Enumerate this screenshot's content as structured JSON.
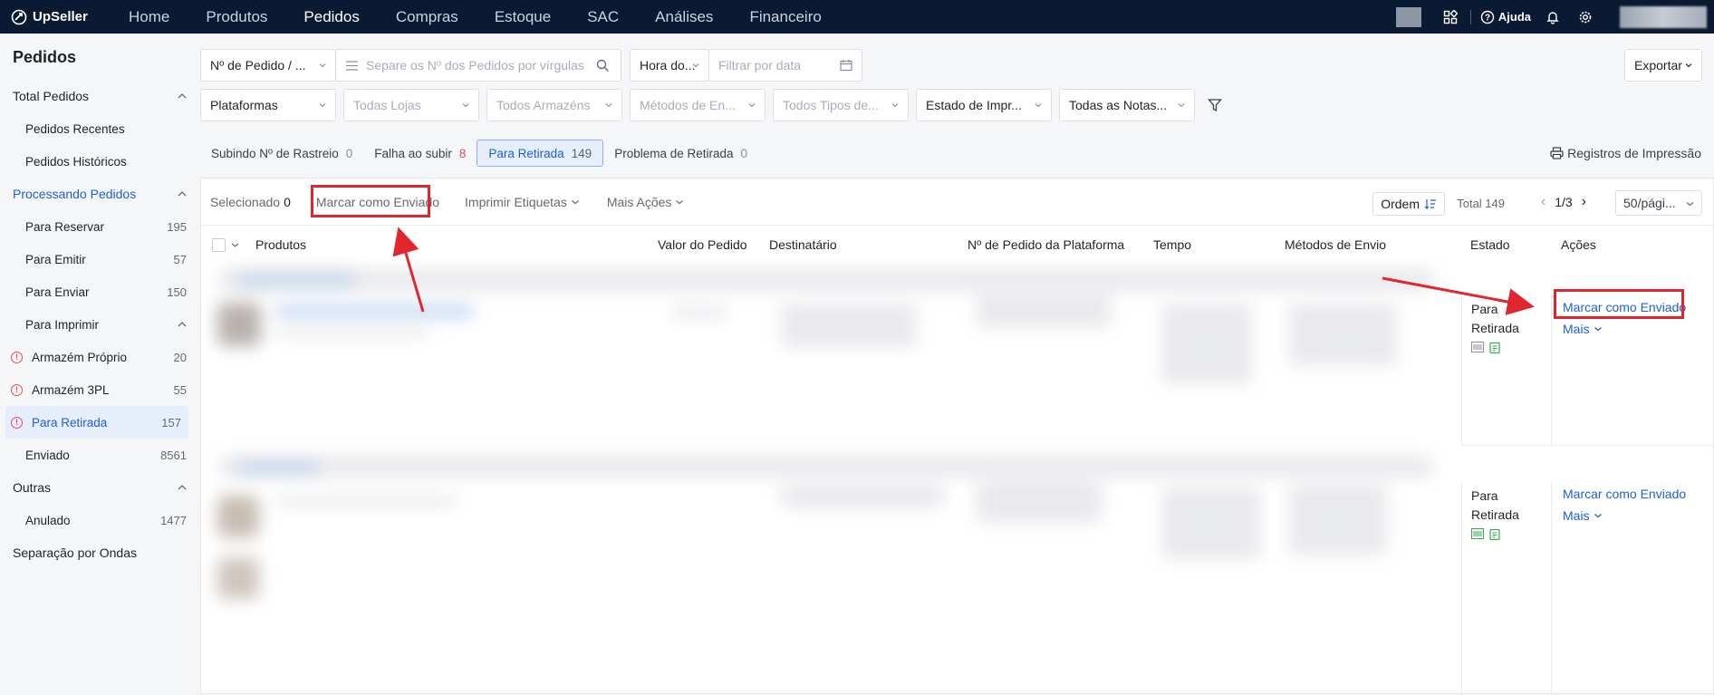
{
  "app": {
    "name": "UpSeller"
  },
  "nav": {
    "items": [
      "Home",
      "Produtos",
      "Pedidos",
      "Compras",
      "Estoque",
      "SAC",
      "Análises",
      "Financeiro"
    ],
    "active": "Pedidos"
  },
  "topright": {
    "help_label": "Ajuda"
  },
  "sidebar": {
    "title": "Pedidos",
    "total_group": "Total Pedidos",
    "recentes": "Pedidos Recentes",
    "historicos": "Pedidos Históricos",
    "processando_group": "Processando Pedidos",
    "reservar": {
      "label": "Para Reservar",
      "count": "195"
    },
    "emitir": {
      "label": "Para Emitir",
      "count": "57"
    },
    "enviar": {
      "label": "Para Enviar",
      "count": "150"
    },
    "imprimir_group": "Para Imprimir",
    "proprio": {
      "label": "Armazém Próprio",
      "count": "20"
    },
    "tercpl": {
      "label": "Armazém 3PL",
      "count": "55"
    },
    "retirada": {
      "label": "Para Retirada",
      "count": "157"
    },
    "enviado": {
      "label": "Enviado",
      "count": "8561"
    },
    "outras_group": "Outras",
    "anulado": {
      "label": "Anulado",
      "count": "1477"
    },
    "ondas": "Separação por Ondas"
  },
  "filters": {
    "pedido_type": "Nº de Pedido / ...",
    "search_placeholder": "Separe os Nº dos Pedidos por vírgulas",
    "hora": "Hora do...",
    "date_placeholder": "Filtrar por data",
    "exportar": "Exportar",
    "plataformas": "Plataformas",
    "lojas": "Todas Lojas",
    "armazens": "Todos Armazéns",
    "metodos": "Métodos de En...",
    "tipos": "Todos Tipos de...",
    "estado_impr": "Estado de Impr...",
    "notas": "Todas as Notas..."
  },
  "tabs": [
    {
      "label": "Subindo Nº de Rastreio",
      "count": "0"
    },
    {
      "label": "Falha ao subir",
      "count": "8"
    },
    {
      "label": "Para Retirada",
      "count": "149"
    },
    {
      "label": "Problema de Retirada",
      "count": "0"
    }
  ],
  "registros": "Registros de Impressão",
  "toolbar": {
    "selecionado_label": "Selecionado",
    "selecionado_count": "0",
    "marcar": "Marcar como Enviado",
    "imprimir": "Imprimir Etiquetas",
    "mais_acoes": "Mais Ações",
    "ordem": "Ordem",
    "total": "Total 149",
    "page": "1/3",
    "per_page": "50/pági..."
  },
  "columns": {
    "produtos": "Produtos",
    "valor": "Valor do Pedido",
    "destinatario": "Destinatário",
    "plataforma": "Nº de Pedido da Plataforma",
    "tempo": "Tempo",
    "metodos": "Métodos de Envio",
    "estado": "Estado",
    "acoes": "Ações"
  },
  "orders": [
    {
      "estado_line1": "Para",
      "estado_line2": "Retirada",
      "acao": "Marcar como Enviado",
      "mais": "Mais"
    },
    {
      "estado_line1": "Para",
      "estado_line2": "Retirada",
      "acao": "Marcar como Enviado",
      "mais": "Mais"
    }
  ],
  "colors": {
    "topbar": "#0b1a33",
    "link": "#1e5fd6",
    "highlight": "#e0262f"
  }
}
